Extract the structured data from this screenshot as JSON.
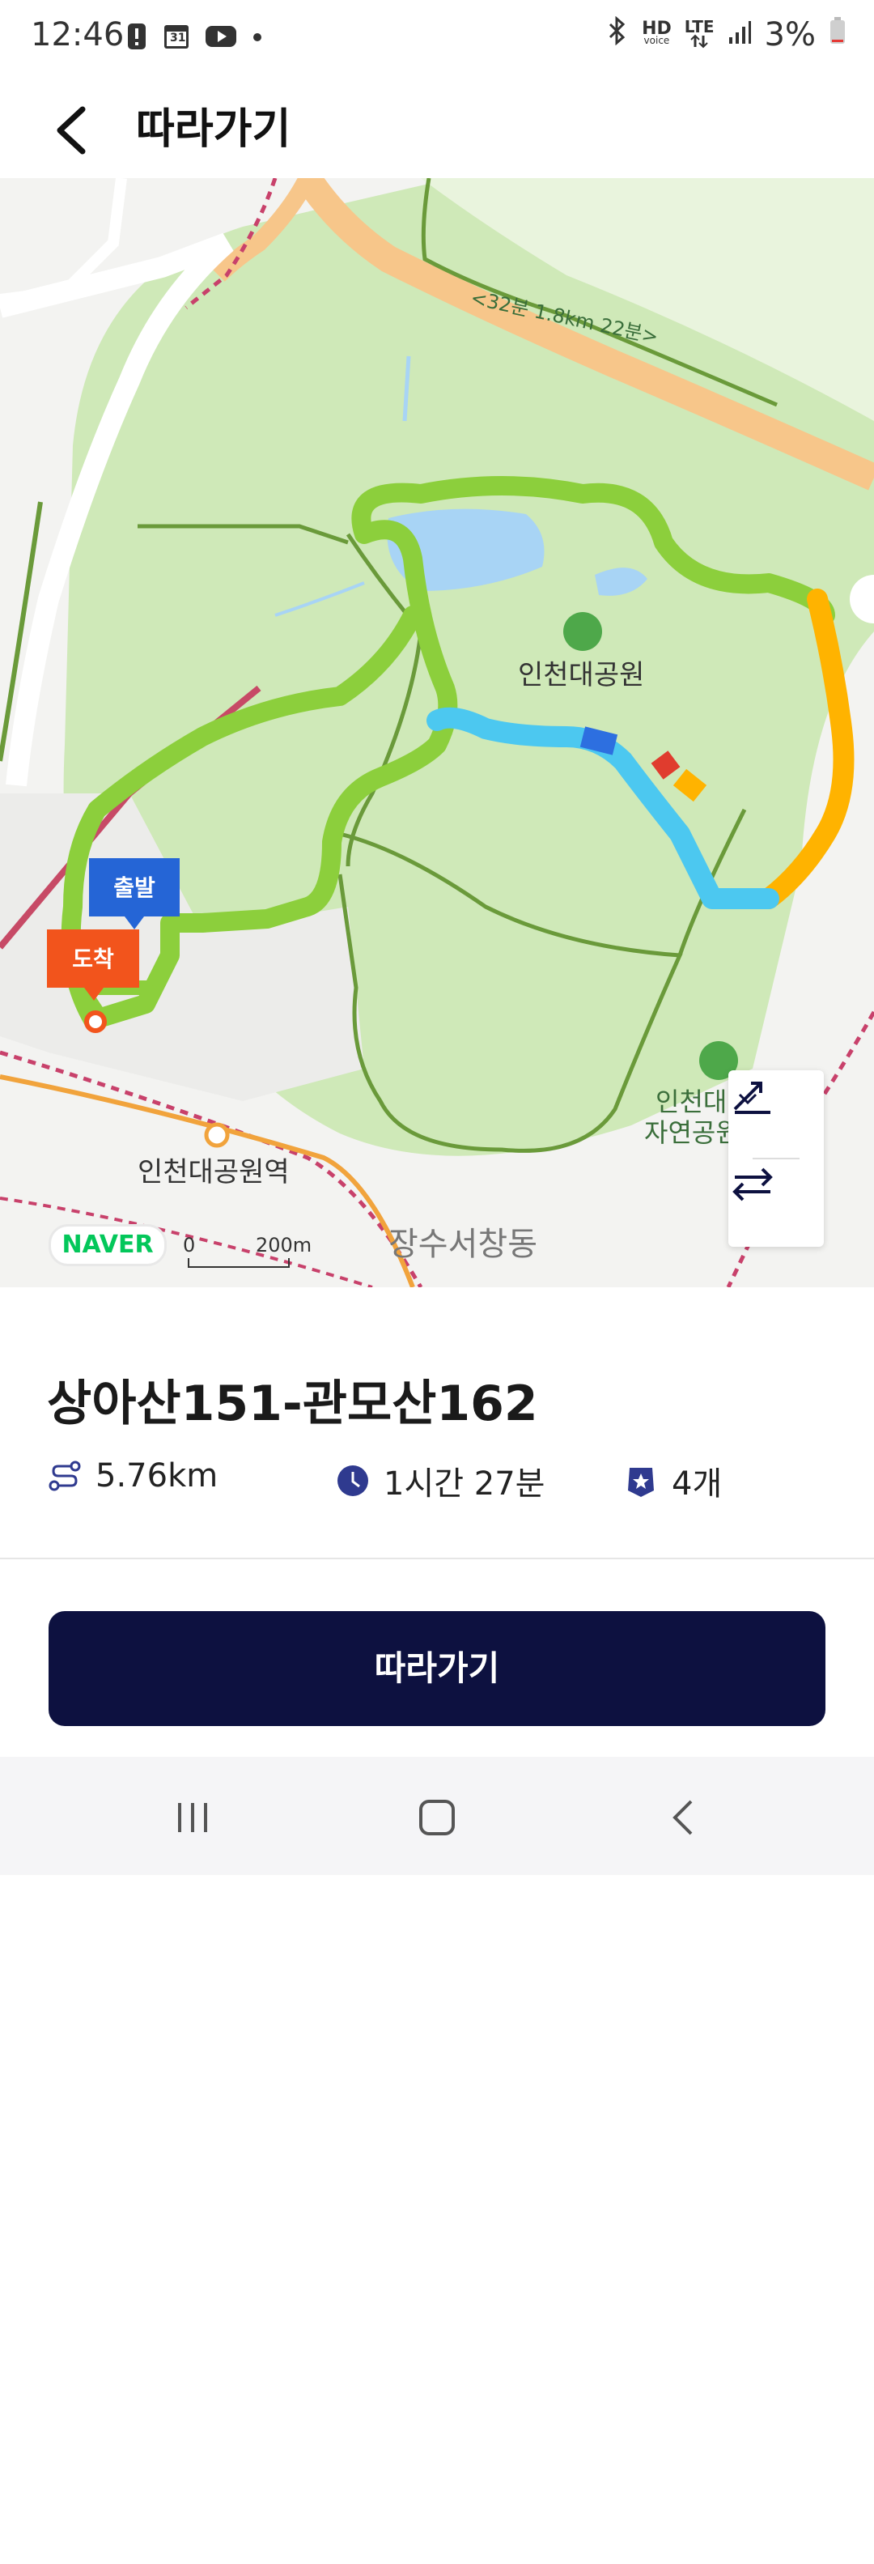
{
  "status_bar": {
    "time": "12:46",
    "left_icons": [
      "alert-icon",
      "calendar-icon",
      "youtube-icon",
      "dot-icon"
    ],
    "calendar_day": "31",
    "hd_label": "HD",
    "voice_label": "voice",
    "lte_label": "LTE",
    "battery": "3%"
  },
  "header": {
    "title": "따라가기"
  },
  "map": {
    "park_label": "인천대공원",
    "station_label": "인천대공원역",
    "district_label": "장수서창동",
    "nature_label_line1": "인천대",
    "nature_label_line2": "자연공원",
    "road_label": "<32분 1.8km 22분>",
    "start_marker": "출발",
    "end_marker": "도착",
    "provider": "NAVER",
    "scale_zero": "0",
    "scale_distance": "200m",
    "colors": {
      "route_green": "#8ccf3c",
      "route_blue": "#4cc8f0",
      "route_orange": "#ffb300",
      "route_red": "#e03c2e",
      "park_green": "#cfe9b8",
      "water": "#a8d4f5",
      "road_orange": "#f7c68a",
      "trail": "#6a9a3a"
    }
  },
  "course": {
    "title": "상아산151-관모산162",
    "distance": "5.76km",
    "duration": "1시간 27분",
    "count": "4개"
  },
  "actions": {
    "follow_label": "따라가기"
  },
  "nav_bar": {
    "items": [
      "recent-apps-icon",
      "home-icon",
      "back-icon"
    ]
  }
}
